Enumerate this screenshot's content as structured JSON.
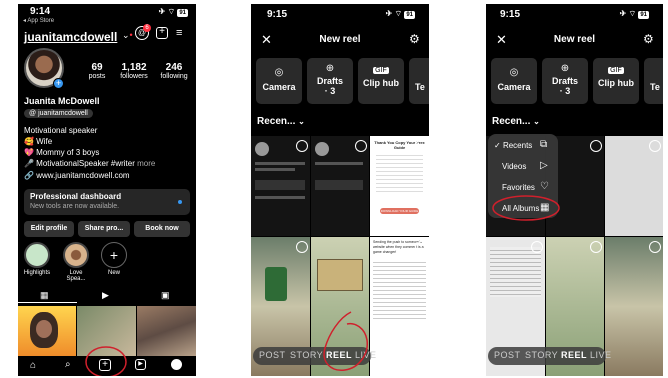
{
  "profile": {
    "status": {
      "time": "9:14",
      "back_label": "◂ App Store",
      "battery": "91"
    },
    "username": "juanitamcdowell",
    "notif_count": "6",
    "stats": [
      {
        "value": "69",
        "label": "posts"
      },
      {
        "value": "1,182",
        "label": "followers"
      },
      {
        "value": "246",
        "label": "following"
      }
    ],
    "name": "Juanita McDowell",
    "threads_handle": "juanitamcdowell",
    "bio": [
      "Motivational speaker",
      "🥰 Wife",
      "💖 Mommy of 3 boys",
      "🎤 MotivationalSpeaker #writer"
    ],
    "more": "more",
    "link": "www.juanitamcdowell.com",
    "dashboard": {
      "title": "Professional dashboard",
      "subtitle": "New tools are now available."
    },
    "buttons": {
      "edit": "Edit profile",
      "share": "Share pro...",
      "book": "Book now"
    },
    "highlights": [
      {
        "label": "Highlights"
      },
      {
        "label": "Love Spea..."
      },
      {
        "label": "New"
      }
    ]
  },
  "reel1": {
    "status": {
      "time": "9:15",
      "battery": "91"
    },
    "title": "New reel",
    "tiles": [
      {
        "label": "Camera"
      },
      {
        "label": "Drafts",
        "sub": "· 3"
      },
      {
        "label": "Clip hub"
      },
      {
        "label": "Te"
      }
    ],
    "recents_label": "Recen...",
    "modes": [
      "POST",
      "STORY",
      "REEL",
      "LIVE"
    ],
    "post_preview": {
      "title": "Thank You Copy Your Free Guide",
      "button": "DOWNLOAD YOUR GUIDE",
      "caption": "Sending the push to someone's website when they comment is a game changer!"
    }
  },
  "reel2": {
    "status": {
      "time": "9:15",
      "battery": "91"
    },
    "title": "New reel",
    "tiles": [
      {
        "label": "Camera"
      },
      {
        "label": "Drafts",
        "sub": "· 3"
      },
      {
        "label": "Clip hub"
      },
      {
        "label": "Te"
      }
    ],
    "recents_label": "Recen...",
    "menu": [
      "Recents",
      "Videos",
      "Favorites",
      "All Albums"
    ],
    "modes": [
      "POST",
      "STORY",
      "REEL",
      "LIVE"
    ]
  },
  "colors": {
    "accent_blue": "#3797f0",
    "annotation_red": "#d0202c",
    "notif_red": "#ff3040"
  }
}
